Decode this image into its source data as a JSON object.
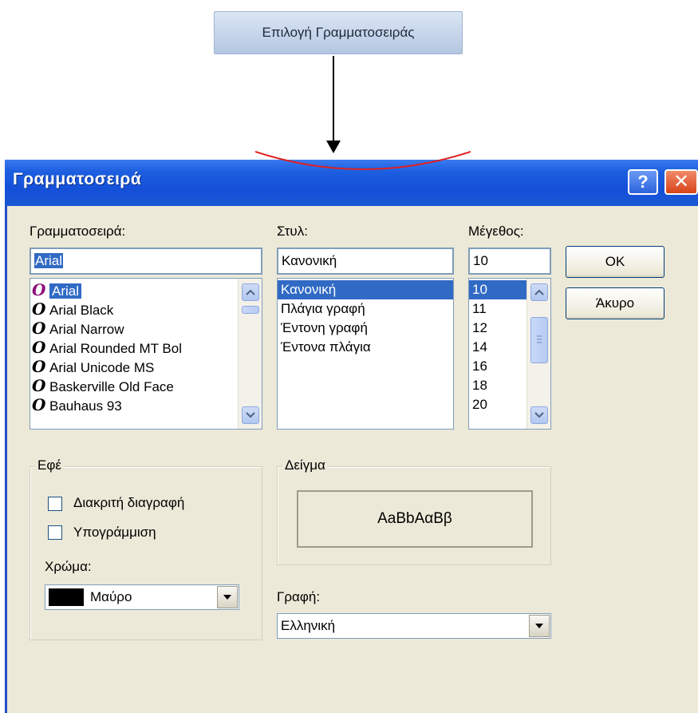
{
  "top_button": {
    "label": "Επιλογή Γραμματοσειράς"
  },
  "dialog": {
    "title": "Γραμματοσειρά",
    "help_label": "?",
    "close_label": "✕",
    "font": {
      "label": "Γραμματοσειρά:",
      "value": "Arial",
      "items": [
        "Arial",
        "Arial Black",
        "Arial Narrow",
        "Arial Rounded MT Bol",
        "Arial Unicode MS",
        "Baskerville Old Face",
        "Bauhaus 93"
      ],
      "icon_glyph": "O"
    },
    "style": {
      "label": "Στυλ:",
      "value": "Κανονική",
      "items": [
        "Κανονική",
        "Πλάγια γραφή",
        "Έντονη γραφή",
        "Έντονα πλάγια"
      ]
    },
    "size": {
      "label": "Μέγεθος:",
      "value": "10",
      "items": [
        "10",
        "11",
        "12",
        "14",
        "16",
        "18",
        "20"
      ]
    },
    "ok_label": "OK",
    "cancel_label": "Άκυρο",
    "effects": {
      "label": "Εφέ",
      "strikeout_label": "Διακριτή διαγραφή",
      "underline_label": "Υπογράμμιση",
      "color_label": "Χρώμα:",
      "color_value": "Μαύρο",
      "color_swatch": "#000000"
    },
    "sample": {
      "label": "Δείγμα",
      "text": "AaBbAαBβ"
    },
    "script": {
      "label": "Γραφή:",
      "value": "Ελληνική"
    }
  },
  "colors": {
    "selection": "#316ac5",
    "annotation_arc": "#e02020",
    "titlebar": "#1450d8"
  }
}
